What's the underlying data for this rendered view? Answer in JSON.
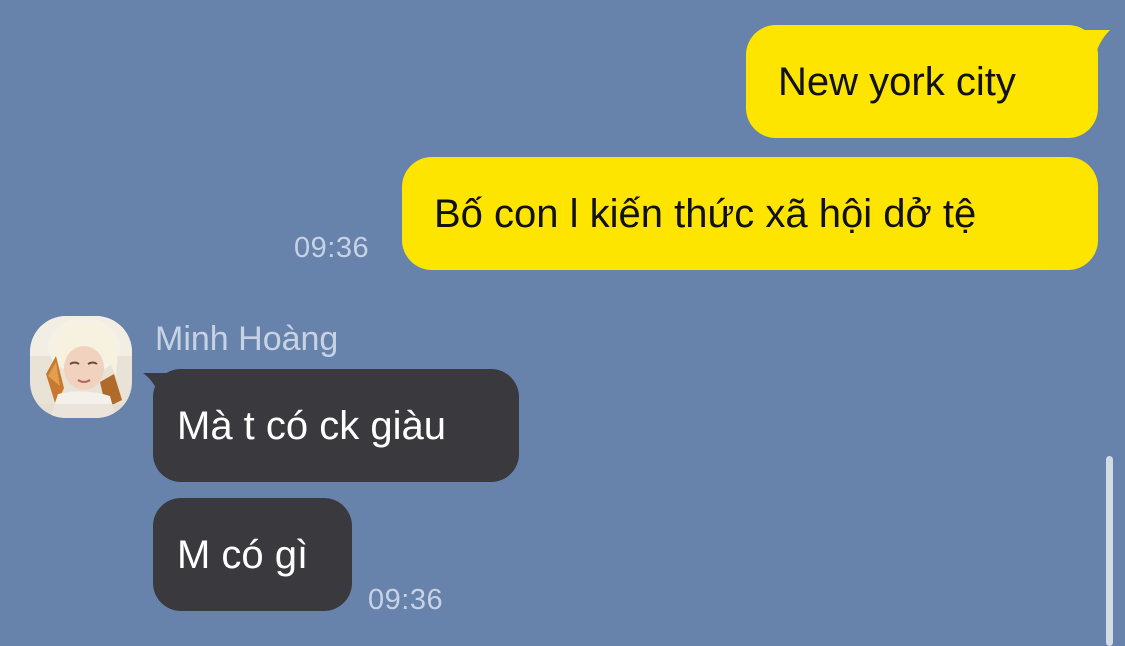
{
  "chat": {
    "outgoing": [
      {
        "text": "New york city"
      },
      {
        "text": "Bố con l kiến thức xã hội dở tệ"
      }
    ],
    "outgoing_time": "09:36",
    "incoming_sender": "Minh Hoàng",
    "incoming": [
      {
        "text": "Mà t có ck giàu"
      },
      {
        "text": "M có gì"
      }
    ],
    "incoming_time": "09:36"
  },
  "colors": {
    "background": "#6783ab",
    "outgoing_bubble": "#fee500",
    "incoming_bubble": "#3a3a3e",
    "timestamp": "#c7d3e4"
  }
}
